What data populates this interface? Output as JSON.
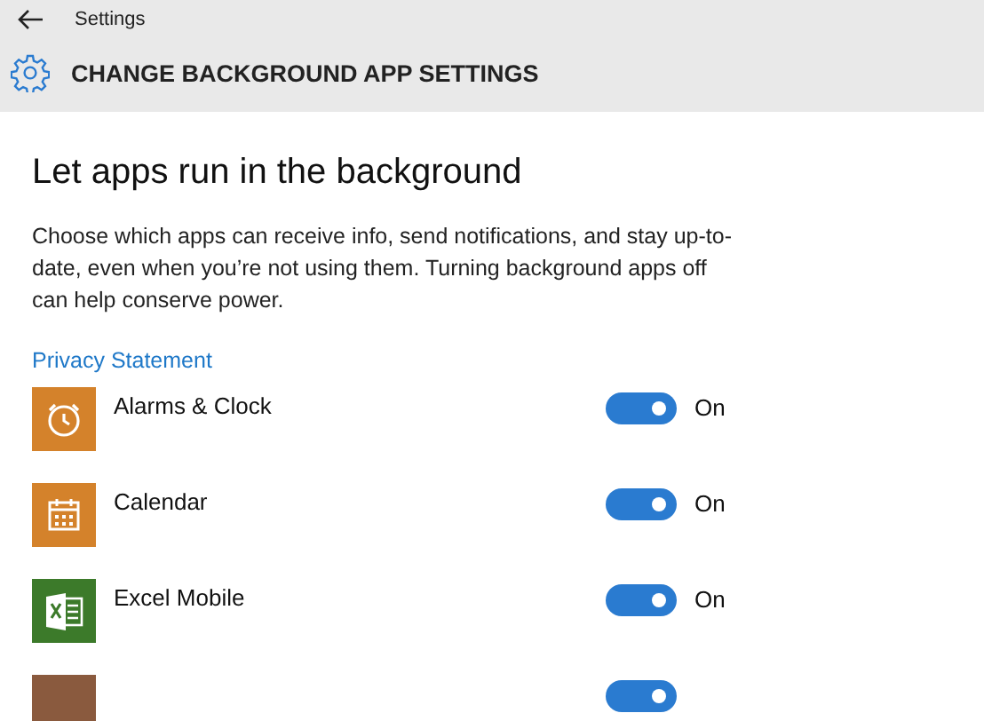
{
  "window": {
    "title": "Settings"
  },
  "header": {
    "title": "CHANGE BACKGROUND APP SETTINGS"
  },
  "heading": "Let apps run in the background",
  "description": "Choose which apps can receive info, send notifications, and stay up-to-date, even when you’re not using them. Turning background apps off can help conserve power.",
  "privacy_link": "Privacy Statement",
  "apps": [
    {
      "kind": "alarm",
      "name": "Alarms & Clock",
      "color": "#d4822b",
      "on": true,
      "state_label": "On"
    },
    {
      "kind": "calendar",
      "name": "Calendar",
      "color": "#d4822b",
      "on": true,
      "state_label": "On"
    },
    {
      "kind": "excel",
      "name": "Excel Mobile",
      "color": "#3c7a2a",
      "on": true,
      "state_label": "On"
    },
    {
      "kind": "blank",
      "color": "#8a5a3e",
      "on": true
    }
  ]
}
